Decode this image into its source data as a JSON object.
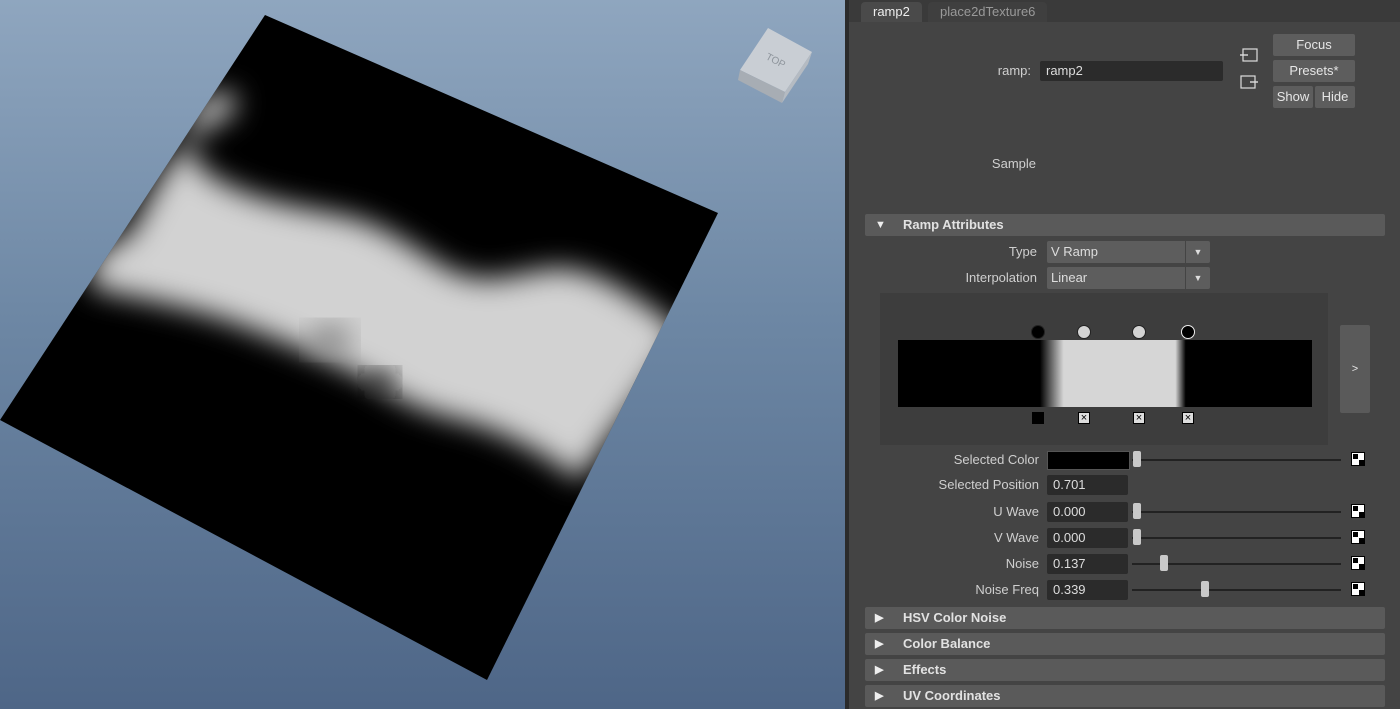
{
  "viewport": {
    "viewcube_label": "TOP"
  },
  "tabs": [
    {
      "label": "ramp2"
    },
    {
      "label": "place2dTexture6"
    }
  ],
  "header": {
    "name_label": "ramp:",
    "name_value": "ramp2",
    "focus_label": "Focus",
    "presets_label": "Presets*",
    "show_label": "Show",
    "hide_label": "Hide",
    "sample_label": "Sample"
  },
  "ramp_section": {
    "title": "Ramp Attributes",
    "type_label": "Type",
    "type_value": "V Ramp",
    "interp_label": "Interpolation",
    "interp_value": "Linear",
    "expand_label": ">"
  },
  "attributes": {
    "selected_color_label": "Selected Color",
    "selected_position_label": "Selected Position",
    "selected_position_value": "0.701",
    "u_wave_label": "U Wave",
    "u_wave_value": "0.000",
    "v_wave_label": "V Wave",
    "v_wave_value": "0.000",
    "noise_label": "Noise",
    "noise_value": "0.137",
    "noise_freq_label": "Noise Freq",
    "noise_freq_value": "0.339"
  },
  "collapsed_sections": [
    {
      "title": "HSV Color Noise"
    },
    {
      "title": "Color Balance"
    },
    {
      "title": "Effects"
    },
    {
      "title": "UV Coordinates"
    }
  ],
  "colors": {
    "selected_color": "#000000",
    "panel_bg": "#444444"
  }
}
